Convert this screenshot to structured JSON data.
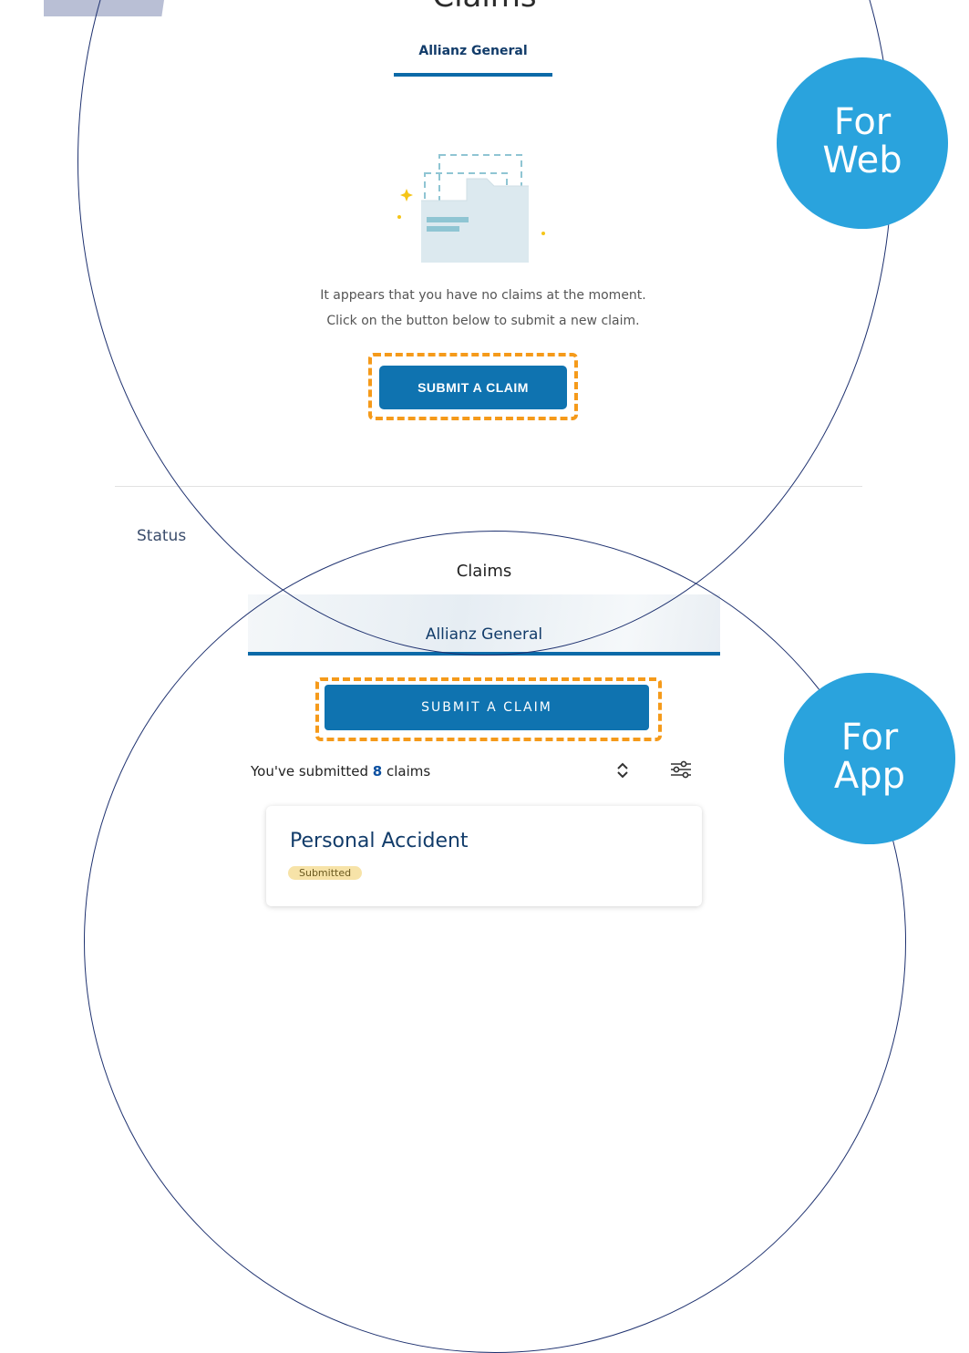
{
  "web": {
    "page_title": "Claims",
    "tab_label": "Allianz General",
    "empty_line1": "It appears that you have no claims at the moment.",
    "empty_line2": "Click on the button below to submit a new claim.",
    "submit_button": "SUBMIT A CLAIM",
    "status_label": "Status"
  },
  "app": {
    "page_title": "Claims",
    "tab_label": "Allianz General",
    "submit_button": "SUBMIT A CLAIM",
    "submitted_prefix": "You've submitted",
    "submitted_count": "8",
    "submitted_suffix": "claims",
    "card_title": "Personal Accident",
    "card_status": "Submitted"
  },
  "badges": {
    "web_line1": "For",
    "web_line2": "Web",
    "app_line1": "For",
    "app_line2": "App"
  },
  "colors": {
    "primary_button": "#0f73b0",
    "badge_blue": "#2aa3dd",
    "highlight_orange": "#f59a1a",
    "navy_outline": "#1f3270"
  },
  "icons": {
    "empty_state": "empty-folder-illustration-icon",
    "sort": "sort-updown-icon",
    "filter": "filter-sliders-icon"
  }
}
